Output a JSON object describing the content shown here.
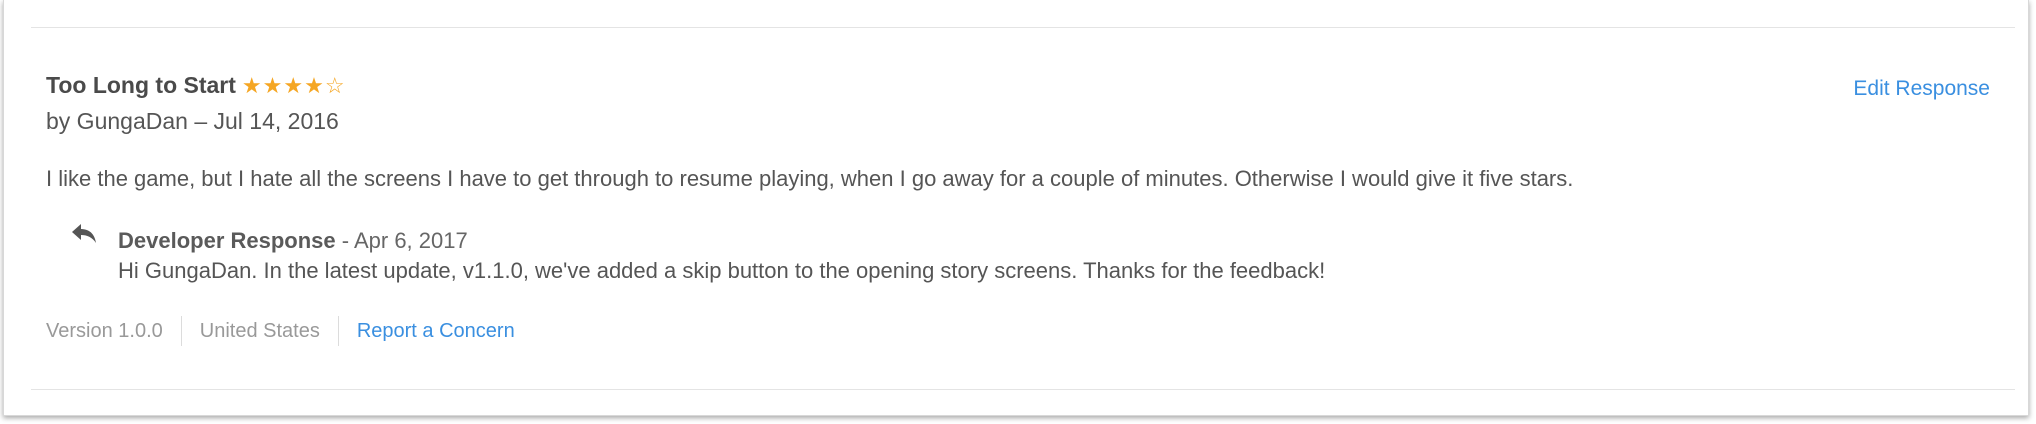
{
  "review": {
    "title": "Too Long to Start",
    "stars_display": "★★★★☆",
    "rating": 4,
    "rating_max": 5,
    "byline": "by GungaDan – Jul 14, 2016",
    "body": "I like the game, but I hate all the screens I have to get through to resume playing, when I go away for a couple of minutes. Otherwise I would give it five stars.",
    "edit_label": "Edit Response"
  },
  "developer_response": {
    "label": "Developer Response",
    "date": " - Apr 6, 2017",
    "body": "Hi GungaDan. In the latest update, v1.1.0, we've added a skip button to the opening story screens. Thanks for the feedback!",
    "icon": "reply-icon"
  },
  "meta": {
    "version": "Version 1.0.0",
    "country": "United States",
    "report_label": "Report a Concern"
  },
  "colors": {
    "star": "#f5a623",
    "link": "#3a8fe0",
    "text": "#555555",
    "muted": "#999999"
  }
}
